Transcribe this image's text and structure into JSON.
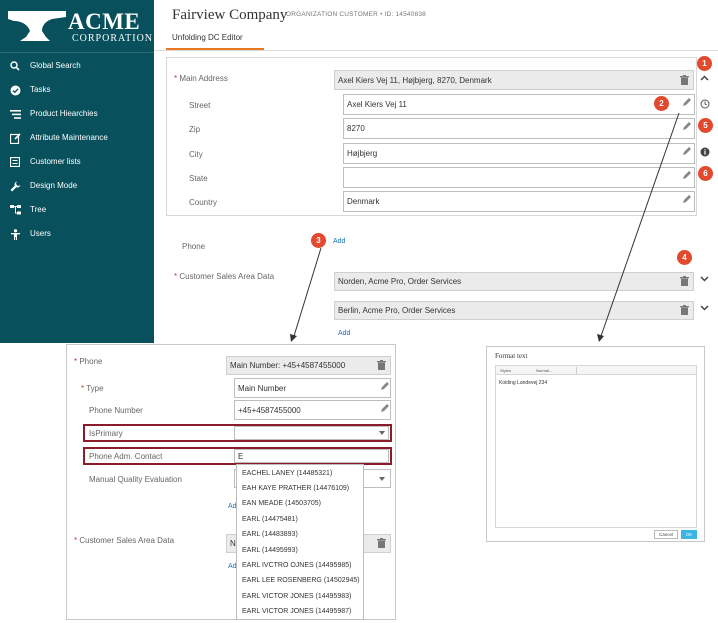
{
  "brand": {
    "name": "ACME",
    "sub": "CORPORATION"
  },
  "sidebar": {
    "items": [
      {
        "label": "Global Search",
        "icon": "search-icon"
      },
      {
        "label": "Tasks",
        "icon": "check-circle-icon"
      },
      {
        "label": "Product Hiearchies",
        "icon": "list-icon"
      },
      {
        "label": "Attribute Maintenance",
        "icon": "edit-box-icon"
      },
      {
        "label": "Customer lists",
        "icon": "table-icon"
      },
      {
        "label": "Design Mode",
        "icon": "wrench-icon"
      },
      {
        "label": "Tree",
        "icon": "tree-icon"
      },
      {
        "label": "Users",
        "icon": "user-icon"
      }
    ]
  },
  "header": {
    "title": "Fairview Company",
    "subtitle": "ORGANIZATION CUSTOMER  •  ID: 14540838",
    "tab": "Unfolding DC Editor"
  },
  "main_address": {
    "label": "Main Address",
    "value": "Axel Kiers Vej 11, Højbjerg, 8270, Denmark",
    "fields": [
      {
        "label": "Street",
        "value": "Axel Kiers Vej 11"
      },
      {
        "label": "Zip",
        "value": "8270"
      },
      {
        "label": "City",
        "value": "Højbjerg"
      },
      {
        "label": "State",
        "value": ""
      },
      {
        "label": "Country",
        "value": "Denmark"
      }
    ]
  },
  "phone": {
    "label": "Phone",
    "add": "Add"
  },
  "sales_area": {
    "label": "Customer Sales Area Data",
    "items": [
      "Norden, Acme Pro, Order Services",
      "Berlin, Acme Pro, Order Services"
    ],
    "add": "Add"
  },
  "markers": [
    "1",
    "2",
    "3",
    "4",
    "5",
    "6"
  ],
  "phone_panel": {
    "phone_label": "Phone",
    "phone_value": "Main Number: +45+4587455000",
    "type_label": "Type",
    "type_value": "Main Number",
    "number_label": "Phone Number",
    "number_value": "+45+4587455000",
    "isprimary_label": "IsPrimary",
    "contact_label": "Phone Adm. Contact",
    "contact_value": "E",
    "mqe_label": "Manual Quality Evaluation",
    "sales_label": "Customer Sales Area Data",
    "sales_value": "N",
    "add_a": "Add",
    "add_b": "Add",
    "dropdown": [
      "EACHEL LANEY (14485321)",
      "EAH KAYE PRATHER (14476109)",
      "EAN MEADE (14503705)",
      "EARL (14475481)",
      "EARL (14483893)",
      "EARL (14495993)",
      "EARL IVCTRO OJNES (14495985)",
      "EARL LEE ROSENBERG (14502945)",
      "EARL VICTOR JONES (14495983)",
      "EARL VICTOR JONES (14495987)"
    ]
  },
  "format_dialog": {
    "title": "Format text",
    "toolbar_style": "Styles",
    "toolbar_format": "Normal...",
    "text": "Kolding Landevej 234",
    "cancel": "Cancel",
    "ok": "OK"
  },
  "colors": {
    "sidebar": "#07505c",
    "accent": "#e87722",
    "marker": "#e24a2f",
    "highlight": "#8b1d2b",
    "link": "#1a6fbf"
  }
}
